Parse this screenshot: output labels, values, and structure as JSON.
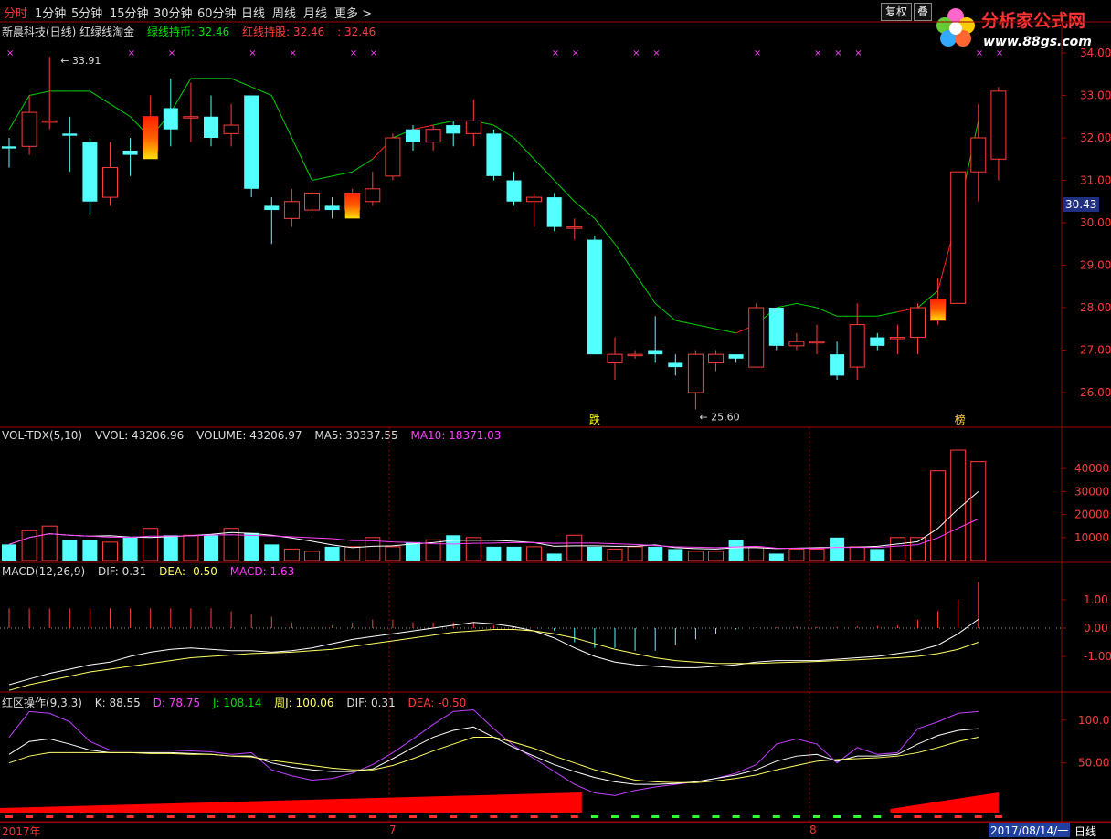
{
  "toolbar": {
    "tabs": [
      "分时",
      "1分钟",
      "5分钟",
      "15分钟",
      "30分钟",
      "60分钟",
      "日线",
      "周线",
      "月线",
      "更多 >"
    ],
    "active": "分时",
    "btn_fuquan": "复权",
    "btn_die": "叠"
  },
  "logo": {
    "text": "分析家公式网",
    "url": "www.88gs.com"
  },
  "main_legend": {
    "title": "新晨科技(日线) 红绿线淘金",
    "green": "绿线持币: 32.46",
    "red": "红线持股: 32.46",
    "red2": ": 32.46"
  },
  "price_axis": [
    "34.00",
    "33.00",
    "32.00",
    "31.00",
    "30.00",
    "29.00",
    "28.00",
    "27.00",
    "26.00"
  ],
  "price_current": "30.43",
  "annotations": {
    "high": "33.91",
    "low": "25.60",
    "die": "跌",
    "bang": "榜"
  },
  "vol_legend": {
    "name": "VOL-TDX(5,10)",
    "vvol": "VVOL: 43206.96",
    "volume": "VOLUME: 43206.97",
    "ma5": "MA5: 30337.55",
    "ma10": "MA10: 18371.03"
  },
  "vol_axis": [
    "40000",
    "30000",
    "20000",
    "10000"
  ],
  "macd_legend": {
    "name": "MACD(12,26,9)",
    "dif": "DIF: 0.31",
    "dea": "DEA: -0.50",
    "macd": "MACD: 1.63"
  },
  "macd_axis": [
    "1.00",
    "0.00",
    "-1.00"
  ],
  "kdj_legend": {
    "name": "红区操作(9,3,3)",
    "k": "K: 88.55",
    "d": "D: 78.75",
    "j": "J: 108.14",
    "zj": "周J: 100.06",
    "dif": "DIF: 0.31",
    "dea": "DEA: -0.50"
  },
  "kdj_axis": [
    "100.0",
    "50.00"
  ],
  "date_axis": {
    "left": "2017年",
    "m7": "7",
    "m8": "8",
    "cursor": "2017/08/14/一",
    "period": "日线"
  },
  "colors": {
    "up": "#ff3c3c",
    "down": "#54ffff",
    "green_line": "#00d000",
    "red_line": "#ff2020",
    "grid": "#a00000",
    "ma10": "#ff40ff"
  },
  "chart_data": {
    "type": "candlestick",
    "candles": [
      {
        "o": 31.8,
        "c": 31.75,
        "h": 32.0,
        "l": 31.3
      },
      {
        "o": 31.8,
        "c": 32.6,
        "h": 33.0,
        "l": 31.6
      },
      {
        "o": 32.4,
        "c": 32.4,
        "h": 33.91,
        "l": 32.2
      },
      {
        "o": 32.1,
        "c": 32.05,
        "h": 32.5,
        "l": 31.2
      },
      {
        "o": 31.9,
        "c": 30.5,
        "h": 32.0,
        "l": 30.2
      },
      {
        "o": 30.6,
        "c": 31.3,
        "h": 31.9,
        "l": 30.4
      },
      {
        "o": 31.7,
        "c": 31.6,
        "h": 32.0,
        "l": 31.1
      },
      {
        "o": 31.7,
        "c": 32.5,
        "h": 33.0,
        "l": 31.6
      },
      {
        "o": 32.7,
        "c": 32.2,
        "h": 33.4,
        "l": 31.8
      },
      {
        "o": 32.5,
        "c": 32.5,
        "h": 33.3,
        "l": 31.9
      },
      {
        "o": 32.5,
        "c": 32.0,
        "h": 33.0,
        "l": 31.8
      },
      {
        "o": 32.1,
        "c": 32.3,
        "h": 32.8,
        "l": 31.8
      },
      {
        "o": 33.0,
        "c": 30.8,
        "h": 33.0,
        "l": 30.6
      },
      {
        "o": 30.4,
        "c": 30.3,
        "h": 30.6,
        "l": 29.5
      },
      {
        "o": 30.1,
        "c": 30.5,
        "h": 30.8,
        "l": 29.9
      },
      {
        "o": 30.3,
        "c": 30.7,
        "h": 31.2,
        "l": 30.1
      },
      {
        "o": 30.4,
        "c": 30.3,
        "h": 30.6,
        "l": 30.1
      },
      {
        "o": 30.3,
        "c": 30.7,
        "h": 30.8,
        "l": 30.1
      },
      {
        "o": 30.5,
        "c": 30.8,
        "h": 31.2,
        "l": 30.4
      },
      {
        "o": 31.1,
        "c": 32.0,
        "h": 32.1,
        "l": 31.0
      },
      {
        "o": 32.2,
        "c": 31.9,
        "h": 32.3,
        "l": 31.7
      },
      {
        "o": 31.9,
        "c": 32.2,
        "h": 32.3,
        "l": 31.7
      },
      {
        "o": 32.3,
        "c": 32.1,
        "h": 32.4,
        "l": 31.8
      },
      {
        "o": 32.1,
        "c": 32.4,
        "h": 32.9,
        "l": 31.8
      },
      {
        "o": 32.1,
        "c": 31.1,
        "h": 32.2,
        "l": 31.0
      },
      {
        "o": 31.0,
        "c": 30.5,
        "h": 31.2,
        "l": 30.4
      },
      {
        "o": 30.5,
        "c": 30.6,
        "h": 30.7,
        "l": 29.9
      },
      {
        "o": 30.6,
        "c": 29.9,
        "h": 30.7,
        "l": 29.8
      },
      {
        "o": 29.9,
        "c": 29.9,
        "h": 30.1,
        "l": 29.6
      },
      {
        "o": 29.6,
        "c": 26.9,
        "h": 29.7,
        "l": 26.9
      },
      {
        "o": 26.7,
        "c": 26.9,
        "h": 27.3,
        "l": 26.3
      },
      {
        "o": 26.9,
        "c": 26.9,
        "h": 27.0,
        "l": 26.8
      },
      {
        "o": 27.0,
        "c": 26.9,
        "h": 27.8,
        "l": 26.7
      },
      {
        "o": 26.7,
        "c": 26.6,
        "h": 26.9,
        "l": 26.4
      },
      {
        "o": 26.0,
        "c": 26.9,
        "h": 27.0,
        "l": 25.6
      },
      {
        "o": 26.7,
        "c": 26.9,
        "h": 27.0,
        "l": 26.5
      },
      {
        "o": 26.9,
        "c": 26.8,
        "h": 26.9,
        "l": 26.7
      },
      {
        "o": 26.6,
        "c": 28.0,
        "h": 28.1,
        "l": 26.6
      },
      {
        "o": 28.0,
        "c": 27.1,
        "h": 28.0,
        "l": 27.0
      },
      {
        "o": 27.1,
        "c": 27.2,
        "h": 27.4,
        "l": 27.0
      },
      {
        "o": 27.2,
        "c": 27.2,
        "h": 27.6,
        "l": 26.9
      },
      {
        "o": 26.9,
        "c": 26.4,
        "h": 27.2,
        "l": 26.3
      },
      {
        "o": 26.6,
        "c": 27.6,
        "h": 28.1,
        "l": 26.3
      },
      {
        "o": 27.3,
        "c": 27.1,
        "h": 27.4,
        "l": 27.0
      },
      {
        "o": 27.3,
        "c": 27.3,
        "h": 27.6,
        "l": 26.9
      },
      {
        "o": 27.3,
        "c": 28.0,
        "h": 28.1,
        "l": 26.9
      },
      {
        "o": 27.7,
        "c": 28.2,
        "h": 28.7,
        "l": 27.6
      },
      {
        "o": 28.1,
        "c": 31.2,
        "h": 31.2,
        "l": 28.1
      },
      {
        "o": 31.2,
        "c": 32.0,
        "h": 32.8,
        "l": 30.5
      },
      {
        "o": 31.5,
        "c": 33.1,
        "h": 33.2,
        "l": 31.0
      }
    ],
    "volumes": [
      7,
      13,
      15,
      9,
      9,
      8,
      10,
      14,
      11,
      11,
      11,
      14,
      12,
      7,
      5,
      4,
      6,
      6,
      10,
      6,
      8,
      9,
      11,
      10,
      6,
      6,
      6,
      3,
      11,
      6,
      5,
      6,
      6,
      5,
      4,
      4,
      9,
      6,
      3,
      5,
      5,
      10,
      6,
      5,
      10,
      10,
      39,
      48,
      43
    ],
    "macd_bars": [
      0.7,
      0.7,
      0.7,
      0.7,
      0.7,
      0.7,
      0.7,
      0.7,
      0.7,
      0.7,
      0.7,
      0.6,
      0.5,
      0.4,
      0.2,
      0.1,
      0.1,
      0.2,
      0.3,
      0.3,
      0.2,
      0.2,
      0.2,
      0.2,
      0.1,
      0.05,
      0.03,
      -0.1,
      -0.5,
      -0.7,
      -0.7,
      -0.8,
      -0.8,
      -0.6,
      -0.4,
      -0.2,
      -0.05,
      0.02,
      0.03,
      0.05,
      0.05,
      0.05,
      0.06,
      0.08,
      0.1,
      0.3,
      0.6,
      1.0,
      1.63
    ]
  }
}
